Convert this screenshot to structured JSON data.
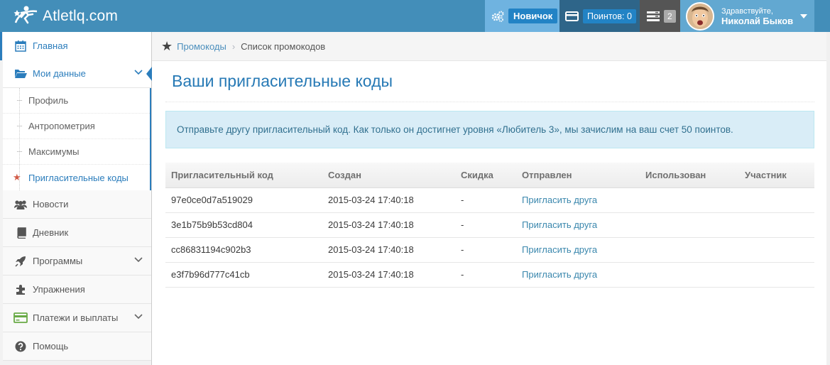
{
  "brand": {
    "name": "Atletlq.com"
  },
  "navbar": {
    "level_label": "Новичок",
    "points_label": "Поинтов: 0",
    "tasks_count": "2",
    "greeting": "Здравствуйте,",
    "user_name": "Николай Быков"
  },
  "sidebar": {
    "items": [
      {
        "label": "Главная",
        "icon": "calendar-icon"
      },
      {
        "label": "Мои данные",
        "icon": "folder-open-icon"
      },
      {
        "label": "Новости",
        "icon": "users-icon"
      },
      {
        "label": "Дневник",
        "icon": "book-icon"
      },
      {
        "label": "Программы",
        "icon": "rocket-icon"
      },
      {
        "label": "Упражнения",
        "icon": "puzzle-icon"
      },
      {
        "label": "Платежи и выплаты",
        "icon": "credit-card-icon"
      },
      {
        "label": "Помощь",
        "icon": "question-icon"
      }
    ],
    "subitems": [
      {
        "label": "Профиль"
      },
      {
        "label": "Антропометрия"
      },
      {
        "label": "Максимумы"
      },
      {
        "label": "Пригласительные коды"
      }
    ]
  },
  "breadcrumb": {
    "link": "Промокоды",
    "current": "Список промокодов"
  },
  "main": {
    "title": "Ваши пригласительные коды",
    "info": "Отправьте другу пригласительный код. Как только он достигнет уровня «Любитель 3», мы зачислим на ваш счет 50 поинтов.",
    "columns": [
      "Пригласительный код",
      "Создан",
      "Скидка",
      "Отправлен",
      "Использован",
      "Участник"
    ],
    "rows": [
      {
        "code": "97e0ce0d7a519029",
        "created": "2015-03-24 17:40:18",
        "discount": "-",
        "sent": "Пригласить друга"
      },
      {
        "code": "3e1b75b9b53cd804",
        "created": "2015-03-24 17:40:18",
        "discount": "-",
        "sent": "Пригласить друга"
      },
      {
        "code": "cc86831194c902b3",
        "created": "2015-03-24 17:40:18",
        "discount": "-",
        "sent": "Пригласить друга"
      },
      {
        "code": "e3f7b96d777c41cb",
        "created": "2015-03-24 17:40:18",
        "discount": "-",
        "sent": "Пригласить друга"
      }
    ]
  },
  "colors": {
    "navbar": "#438eb9",
    "accent": "#2b7dbc",
    "title": "#2679b5",
    "info_bg": "#d9edf7",
    "info_text": "#31708f"
  }
}
